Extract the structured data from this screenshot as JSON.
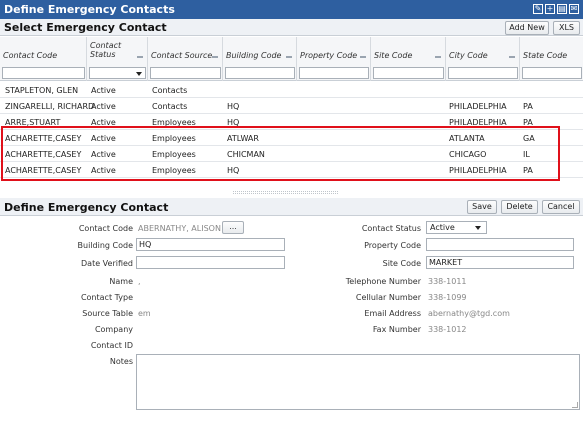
{
  "window": {
    "title": "Define Emergency Contacts",
    "colors": {
      "titlebar": "#2e5fa0",
      "highlight": "#e0101a"
    },
    "icons": [
      "edit-icon",
      "new-window-icon",
      "print-icon",
      "email-icon"
    ]
  },
  "select_panel": {
    "title": "Select Emergency Contact",
    "add_new_label": "Add New",
    "xls_label": "XLS",
    "columns": [
      "Contact Code",
      "Contact Status",
      "Contact Source",
      "Building Code",
      "Property Code",
      "Site Code",
      "City Code",
      "State Code"
    ],
    "rows": [
      [
        "STAPLETON, GLEN",
        "Active",
        "Contacts",
        "",
        "",
        "",
        "",
        ""
      ],
      [
        "ZINGARELLI, RICHARD",
        "Active",
        "Contacts",
        "HQ",
        "",
        "",
        "PHILADELPHIA",
        "PA"
      ],
      [
        "ARRE,STUART",
        "Active",
        "Employees",
        "HQ",
        "",
        "",
        "PHILADELPHIA",
        "PA"
      ],
      [
        "ACHARETTE,CASEY",
        "Active",
        "Employees",
        "ATLWAR",
        "",
        "",
        "ATLANTA",
        "GA"
      ],
      [
        "ACHARETTE,CASEY",
        "Active",
        "Employees",
        "CHICMAN",
        "",
        "",
        "CHICAGO",
        "IL"
      ],
      [
        "ACHARETTE,CASEY",
        "Active",
        "Employees",
        "HQ",
        "",
        "",
        "PHILADELPHIA",
        "PA"
      ]
    ]
  },
  "define_panel": {
    "title": "Define Emergency Contact",
    "save_label": "Save",
    "delete_label": "Delete",
    "cancel_label": "Cancel",
    "labels": {
      "contact_code": "Contact Code",
      "building_code": "Building Code",
      "date_verified": "Date Verified",
      "name": "Name",
      "contact_type": "Contact Type",
      "source_table": "Source Table",
      "company": "Company",
      "contact_id": "Contact ID",
      "notes": "Notes",
      "contact_status": "Contact Status",
      "property_code": "Property Code",
      "site_code": "Site Code",
      "telephone_number": "Telephone Number",
      "cellular_number": "Cellular Number",
      "email_address": "Email Address",
      "fax_number": "Fax Number"
    },
    "values": {
      "contact_code": "ABERNATHY, ALISON",
      "lookup_button": "...",
      "building_code": "HQ",
      "date_verified": "",
      "name": ",",
      "source_table": "em",
      "contact_status": "Active",
      "property_code": "",
      "site_code": "MARKET",
      "telephone_number": "338-1011",
      "cellular_number": "338-1099",
      "email_address": "abernathy@tgd.com",
      "fax_number": "338-1012"
    }
  }
}
